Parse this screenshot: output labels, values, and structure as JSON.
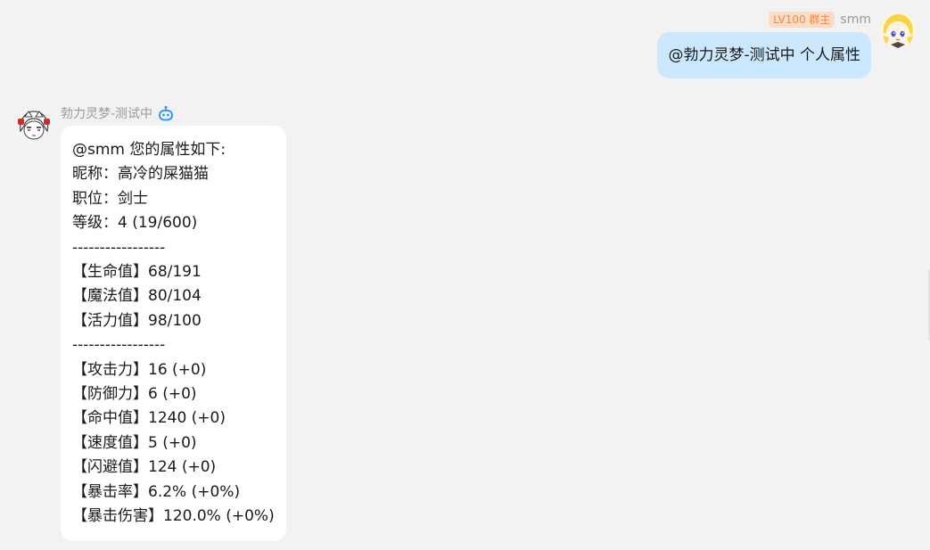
{
  "outgoing": {
    "badge": "LV100 群主",
    "sender": "smm",
    "message": "@勃力灵梦-测试中 个人属性",
    "avatar_icon": "anime-blonde-girl-avatar"
  },
  "incoming": {
    "sender": "勃力灵梦-测试中",
    "bot_icon": "robot-icon",
    "avatar_icon": "anime-white-hair-avatar",
    "lines": [
      "@smm 您的属性如下:",
      "昵称：高冷的屎猫猫",
      "职位：剑士",
      "等级：4 (19/600)",
      "-----------------",
      "【生命值】68/191",
      "【魔法值】80/104",
      "【活力值】98/100",
      "-----------------",
      "【攻击力】16 (+0)",
      "【防御力】6 (+0)",
      "【命中值】1240 (+0)",
      "【速度值】5 (+0)",
      "【闪避值】124 (+0)",
      "【暴击率】6.2% (+0%)",
      "【暴击伤害】120.0% (+0%)"
    ]
  },
  "colors": {
    "background": "#f2f2f2",
    "outgoing_bubble": "#cce8ff",
    "incoming_bubble": "#ffffff",
    "badge_bg": "#fcdcc4",
    "badge_text": "#f08a4b",
    "bot_icon": "#1e90ff"
  }
}
